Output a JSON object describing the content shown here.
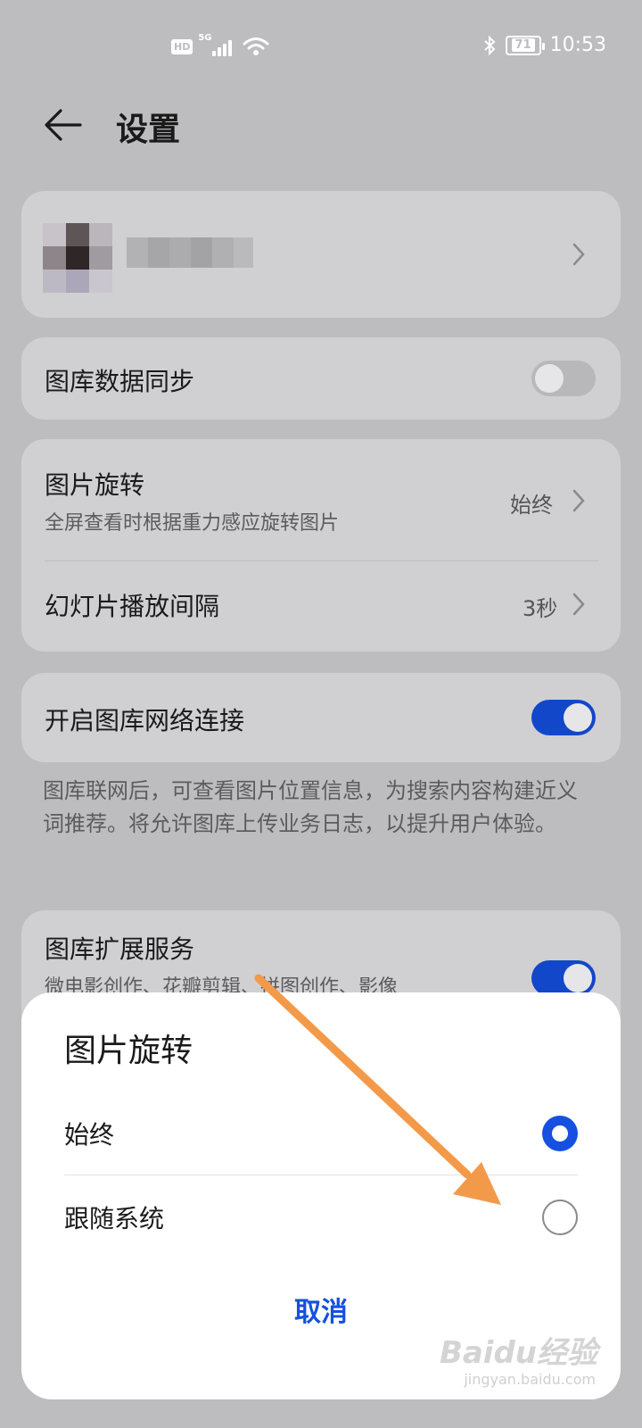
{
  "status_bar": {
    "hd_label": "HD",
    "network_label": "5G",
    "battery_level": "71",
    "time": "10:53"
  },
  "header": {
    "title": "设置"
  },
  "settings": {
    "sync_label": "图库数据同步",
    "sync_enabled": false,
    "rotation_title": "图片旋转",
    "rotation_subtitle": "全屏查看时根据重力感应旋转图片",
    "rotation_value": "始终",
    "slideshow_label": "幻灯片播放间隔",
    "slideshow_value": "3秒",
    "network_label": "开启图库网络连接",
    "network_enabled": true,
    "network_note": "图库联网后，可查看图片位置信息，为搜索内容构建近义词推荐。将允许图库上传业务日志，以提升用户体验。",
    "extension_title": "图库扩展服务",
    "extension_subtitle": "微电影创作、花瓣剪辑、拼图创作、影像",
    "extension_enabled": true
  },
  "dialog": {
    "title": "图片旋转",
    "options": [
      {
        "label": "始终",
        "selected": true
      },
      {
        "label": "跟随系统",
        "selected": false
      }
    ],
    "cancel_label": "取消"
  },
  "watermark": {
    "brand": "Baidu经验",
    "url": "jingyan.baidu.com"
  },
  "colors": {
    "accent": "#1550e0",
    "toggle_on": "#1347c9",
    "annotation_arrow": "#f39a4a"
  }
}
